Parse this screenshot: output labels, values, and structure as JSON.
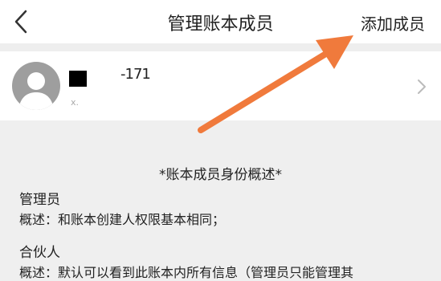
{
  "header": {
    "title": "管理账本成员",
    "action_label": "添加成员"
  },
  "member": {
    "name_visible_fragment": "-171",
    "sub_mark": "x."
  },
  "overview": {
    "title": "*账本成员身份概述*",
    "roles": [
      {
        "name": "管理员",
        "description": "概述：和账本创建人权限基本相同；"
      },
      {
        "name": "合伙人",
        "description": "概述：默认可以看到此账本内所有信息（管理员只能管理其"
      }
    ]
  },
  "colors": {
    "annotation_arrow": "#f07a3c",
    "avatar_bg": "#9e9e9e"
  }
}
